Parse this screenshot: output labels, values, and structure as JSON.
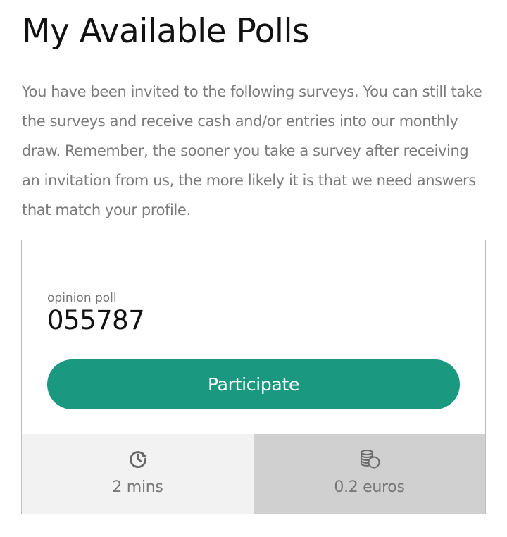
{
  "header": {
    "title": "My Available Polls"
  },
  "intro": {
    "text": "You have been invited to the following surveys. You can still take the surveys and receive cash and/or entries into our monthly draw. Remember, the sooner you take a survey after receiving an invitation from us, the more likely it is that we need answers that match your profile."
  },
  "poll": {
    "type_label": "opinion poll",
    "id": "055787",
    "participate_label": "Participate",
    "time": {
      "icon": "clock-icon",
      "label": "2 mins"
    },
    "reward": {
      "icon": "coins-icon",
      "label": "0.2 euros"
    }
  },
  "colors": {
    "accent": "#1b9880",
    "text_muted": "#777777",
    "title": "#111111",
    "stat_left_bg": "#f2f2f2",
    "stat_right_bg": "#d0d0d0",
    "border": "#bdbdbd"
  }
}
